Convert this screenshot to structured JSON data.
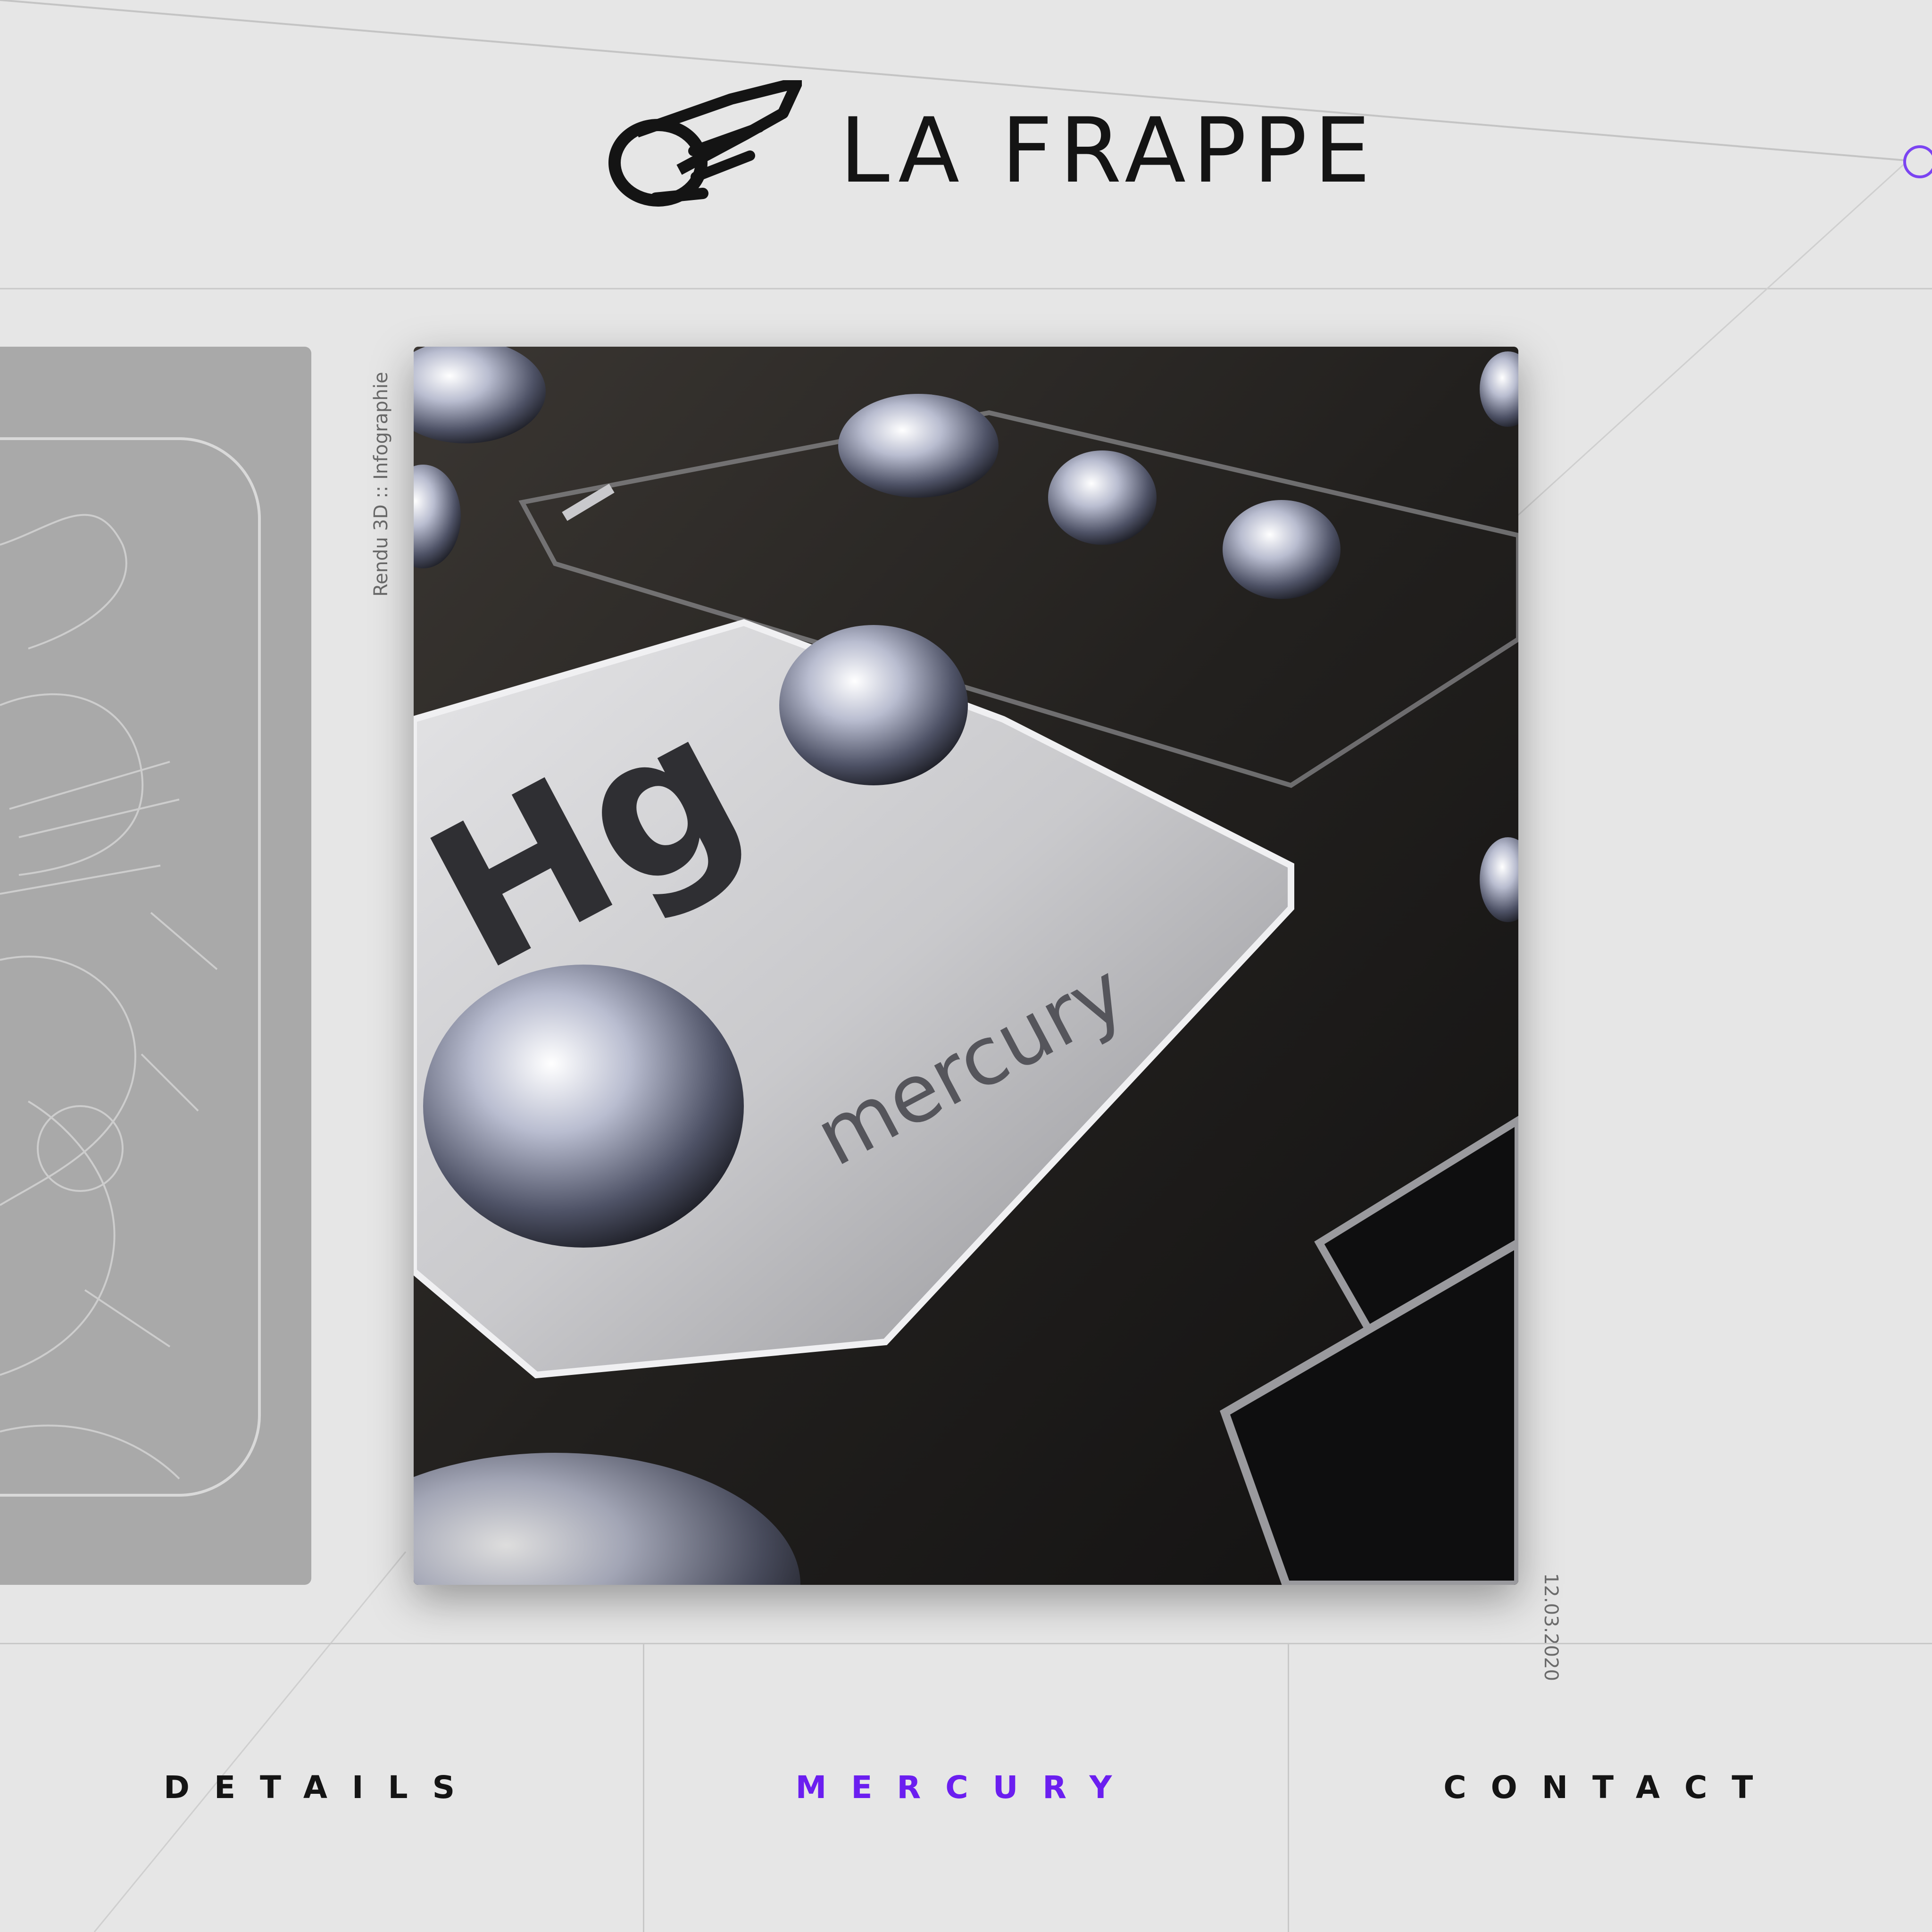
{
  "brand": {
    "name": "LA FRAPPE",
    "logo_icon": "winged-ball-icon"
  },
  "artwork": {
    "category": "Rendu 3D :: Infographie",
    "date": "12.03.2020",
    "embedded_text": {
      "symbol": "Hg",
      "element": "mercury"
    }
  },
  "nav": {
    "items": [
      {
        "label": "DETAILS",
        "active": false
      },
      {
        "label": "MERCURY",
        "active": true
      },
      {
        "label": "CONTACT",
        "active": false
      }
    ]
  },
  "colors": {
    "background": "#e6e6e6",
    "accent": "#6b1ef0",
    "text": "#141414",
    "divider": "#c8c8c8"
  }
}
